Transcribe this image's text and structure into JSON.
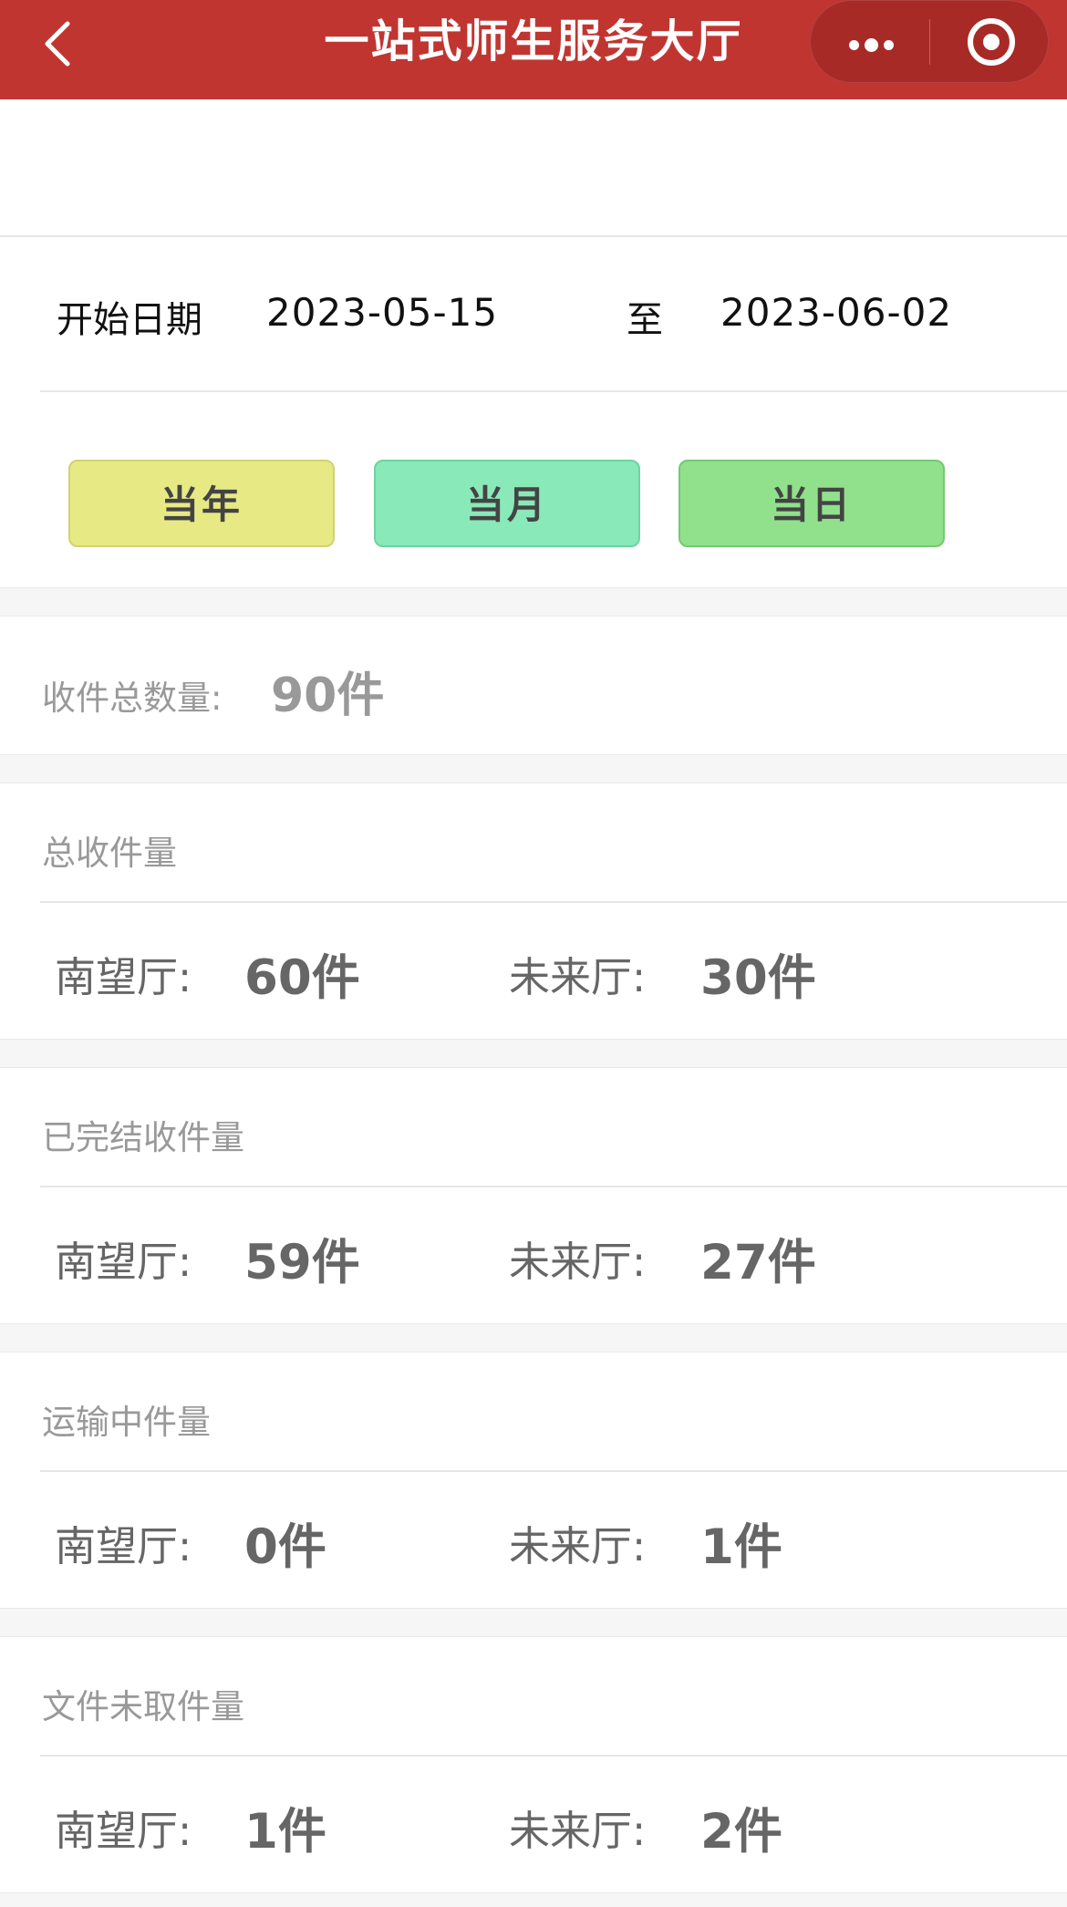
{
  "header": {
    "title": "一站式师生服务大厅",
    "back_icon": "chevron-left-icon",
    "more_icon": "more-dots-icon",
    "close_icon": "target-circle-icon",
    "color": "#c13531"
  },
  "date_range": {
    "start_label": "开始日期",
    "start_value": "2023-05-15",
    "separator": "至",
    "end_value": "2023-06-02"
  },
  "quick_buttons": {
    "year": "当年",
    "month": "当月",
    "day": "当日"
  },
  "total": {
    "label": "收件总数量:",
    "value": "90件"
  },
  "sections": [
    {
      "title": "总收件量",
      "south_label": "南望厅:",
      "south_value": "60件",
      "future_label": "未来厅:",
      "future_value": "30件"
    },
    {
      "title": "已完结收件量",
      "south_label": "南望厅:",
      "south_value": "59件",
      "future_label": "未来厅:",
      "future_value": "27件"
    },
    {
      "title": "运输中件量",
      "south_label": "南望厅:",
      "south_value": "0件",
      "future_label": "未来厅:",
      "future_value": "1件"
    },
    {
      "title": "文件未取件量",
      "south_label": "南望厅:",
      "south_value": "1件",
      "future_label": "未来厅:",
      "future_value": "2件"
    }
  ]
}
